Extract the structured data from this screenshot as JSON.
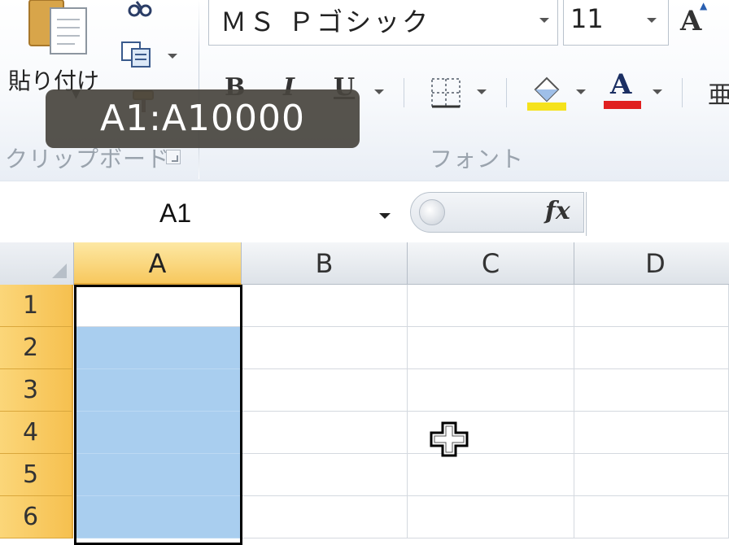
{
  "ribbon": {
    "clipboard": {
      "paste_label": "貼り付け",
      "group_label": "クリップボード"
    },
    "font": {
      "font_name": "ＭＳ Ｐゴシック",
      "font_size": "11",
      "bold": "B",
      "italic": "I",
      "underline": "U",
      "font_color_glyph": "A",
      "grow_font_glyph": "A",
      "group_label": "フォント"
    },
    "alignment_glyph": "亜"
  },
  "tooltip": {
    "text": "A1:A10000"
  },
  "formula_bar": {
    "name_box_value": "A1",
    "fx_label": "fx",
    "formula_value": ""
  },
  "grid": {
    "columns": [
      "A",
      "B",
      "C",
      "D"
    ],
    "rows": [
      "1",
      "2",
      "3",
      "4",
      "5",
      "6"
    ],
    "selected_column": "A",
    "active_cell": "A1",
    "selection_color": "#a9ceef",
    "header_highlight_color": "#f7c85e"
  },
  "icons": {
    "paste": "paste-icon",
    "cut": "scissors-icon",
    "copy": "copy-icon",
    "format_painter": "format-painter-icon",
    "borders": "borders-icon",
    "fill_color": "fill-color-icon",
    "font_color": "font-color-icon",
    "cursor": "cell-select-cursor-icon"
  }
}
